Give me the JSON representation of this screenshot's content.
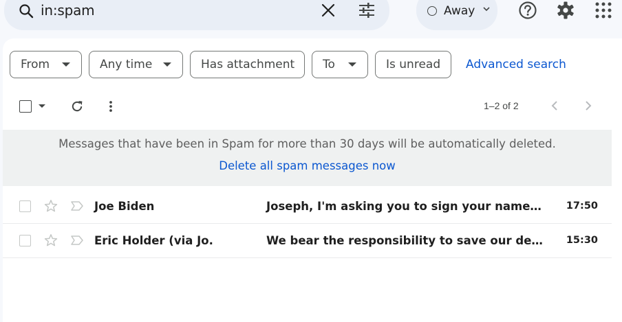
{
  "search": {
    "query": "in:spam"
  },
  "status": {
    "label": "Away"
  },
  "filters": {
    "from": "From",
    "any_time": "Any time",
    "has_attachment": "Has attachment",
    "to": "To",
    "is_unread": "Is unread",
    "advanced_search": "Advanced search"
  },
  "toolbar": {
    "pagination": "1–2 of 2"
  },
  "banner": {
    "message": "Messages that have been in Spam for more than 30 days will be automatically deleted.",
    "action": "Delete all spam messages now"
  },
  "messages": [
    {
      "sender": "Joe Biden",
      "subject": "Joseph, I'm asking you to sign your name…",
      "time": "17:50"
    },
    {
      "sender": "Eric Holder (via Jo.",
      "subject": "We bear the responsibility to save our de…",
      "time": "15:30"
    }
  ],
  "colors": {
    "accent": "#0b57d0",
    "search_bg": "#e9eef6",
    "page_bg": "#f6f8fc",
    "banner_bg": "#eff1f1"
  }
}
